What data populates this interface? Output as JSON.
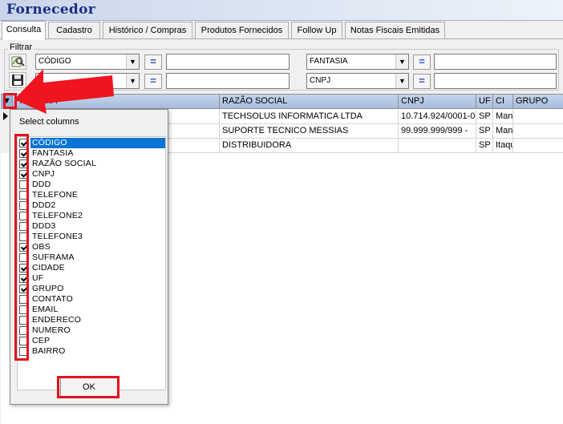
{
  "window": {
    "title": "Fornecedor"
  },
  "tabs": [
    {
      "label": "Consulta",
      "active": true
    },
    {
      "label": "Cadastro",
      "active": false
    },
    {
      "label": "Histórico / Compras",
      "active": false
    },
    {
      "label": "Produtos Fornecidos",
      "active": false
    },
    {
      "label": "Follow Up",
      "active": false
    },
    {
      "label": "Notas Fiscais Emitidas",
      "active": false
    }
  ],
  "filter": {
    "legend": "Filtrar",
    "left_field_1": "CÓDIGO",
    "left_field_2": "",
    "right_field_1": "FANTASIA",
    "right_field_2": "CNPJ",
    "operator_1": "=",
    "operator_2": "=",
    "operator_3": "=",
    "operator_4": "="
  },
  "grid": {
    "columns": [
      "FANTASIA",
      "RAZÃO SOCIAL",
      "CNPJ",
      "UF",
      "CI",
      "GRUPO"
    ],
    "rows": [
      {
        "fantasia": "",
        "razao": "TECHSOLUS INFORMATICA LTDA",
        "cnpj": "10.714.924/0001-0",
        "uf": "SP",
        "cidade": "Man"
      },
      {
        "fantasia": "",
        "razao": "SUPORTE TECNICO MESSIAS",
        "cnpj": "99.999.999/999 -",
        "uf": "SP",
        "cidade": "Man"
      },
      {
        "fantasia": "",
        "razao": "DISTRIBUIDORA",
        "cnpj": "",
        "uf": "SP",
        "cidade": "Itaqu"
      }
    ]
  },
  "column_picker": {
    "title": "Select columns",
    "ok_label": "OK",
    "items": [
      {
        "label": "CÓDIGO",
        "checked": true,
        "selected": true
      },
      {
        "label": "FANTASIA",
        "checked": true,
        "selected": false
      },
      {
        "label": "RAZÃO SOCIAL",
        "checked": true,
        "selected": false
      },
      {
        "label": "CNPJ",
        "checked": true,
        "selected": false
      },
      {
        "label": "DDD",
        "checked": false,
        "selected": false
      },
      {
        "label": "TELEFONE",
        "checked": false,
        "selected": false
      },
      {
        "label": "DDD2",
        "checked": false,
        "selected": false
      },
      {
        "label": "TELEFONE2",
        "checked": false,
        "selected": false
      },
      {
        "label": "DDD3",
        "checked": false,
        "selected": false
      },
      {
        "label": "TELEFONE3",
        "checked": false,
        "selected": false
      },
      {
        "label": "OBS",
        "checked": true,
        "selected": false
      },
      {
        "label": "SUFRAMA",
        "checked": false,
        "selected": false
      },
      {
        "label": "CIDADE",
        "checked": true,
        "selected": false
      },
      {
        "label": "UF",
        "checked": true,
        "selected": false
      },
      {
        "label": "GRUPO",
        "checked": true,
        "selected": false
      },
      {
        "label": "CONTATO",
        "checked": false,
        "selected": false
      },
      {
        "label": "EMAIL",
        "checked": false,
        "selected": false
      },
      {
        "label": "ENDERECO",
        "checked": false,
        "selected": false
      },
      {
        "label": "NUMERO",
        "checked": false,
        "selected": false
      },
      {
        "label": "CEP",
        "checked": false,
        "selected": false
      },
      {
        "label": "BAIRRO",
        "checked": false,
        "selected": false
      }
    ]
  },
  "colors": {
    "title_text": "#1a2d86",
    "selection": "#0a74d6",
    "highlight": "#e0141e"
  }
}
